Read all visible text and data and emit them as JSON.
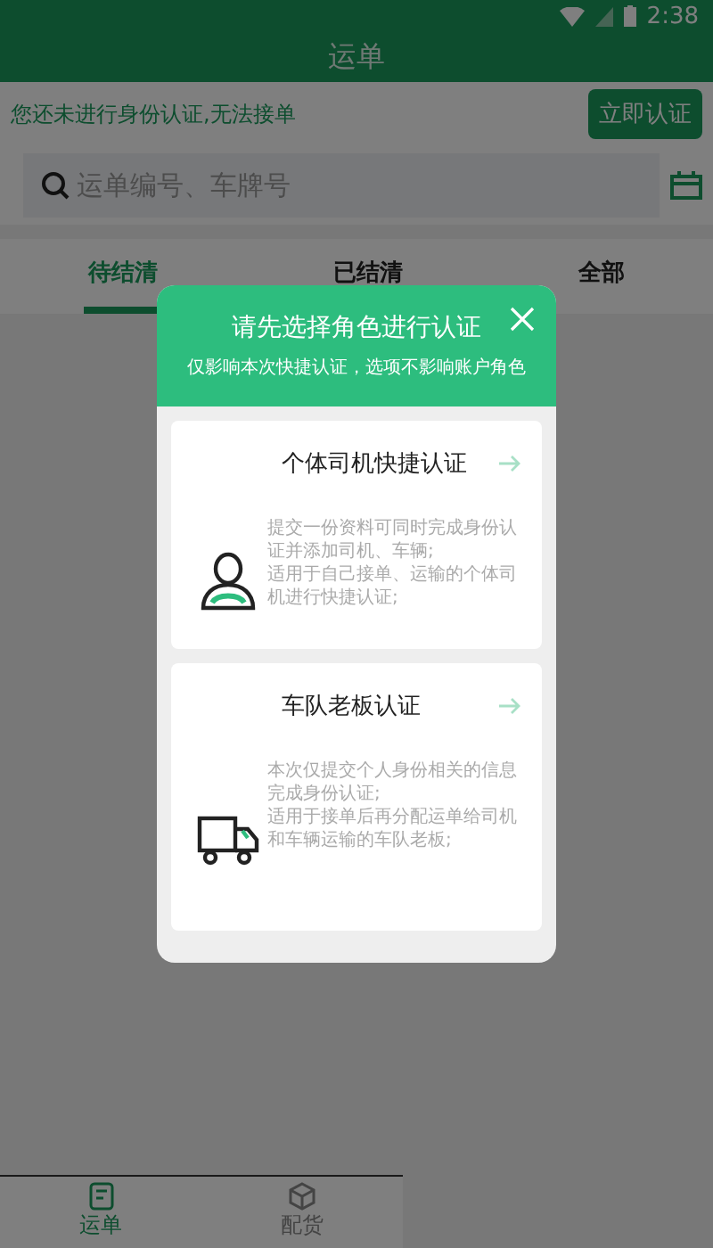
{
  "status_bar": {
    "time": "2:38"
  },
  "header": {
    "title": "运单"
  },
  "notice": {
    "text": "您还未进行身份认证,无法接单",
    "button": "立即认证"
  },
  "search": {
    "placeholder": "运单编号、车牌号"
  },
  "tabs": [
    {
      "label": "待结清",
      "selected": true
    },
    {
      "label": "已结清",
      "selected": false
    },
    {
      "label": "全部",
      "selected": false
    }
  ],
  "dialog": {
    "title": "请先选择角色进行认证",
    "subtitle": "仅影响本次快捷认证，选项不影响账户角色",
    "options": [
      {
        "kind": "driver",
        "title": "个体司机快捷认证",
        "lines": [
          "提交一份资料可同时完成身份认证并添加司机、车辆;",
          "适用于自己接单、运输的个体司机进行快捷认证;"
        ]
      },
      {
        "kind": "fleet",
        "title": "车队老板认证",
        "lines": [
          "本次仅提交个人身份相关的信息完成身份认证;",
          "适用于接单后再分配运单给司机和车辆运输的车队老板;"
        ]
      }
    ]
  },
  "bottom_nav": [
    {
      "label": "运单",
      "selected": true
    },
    {
      "label": "配货",
      "selected": false
    }
  ]
}
